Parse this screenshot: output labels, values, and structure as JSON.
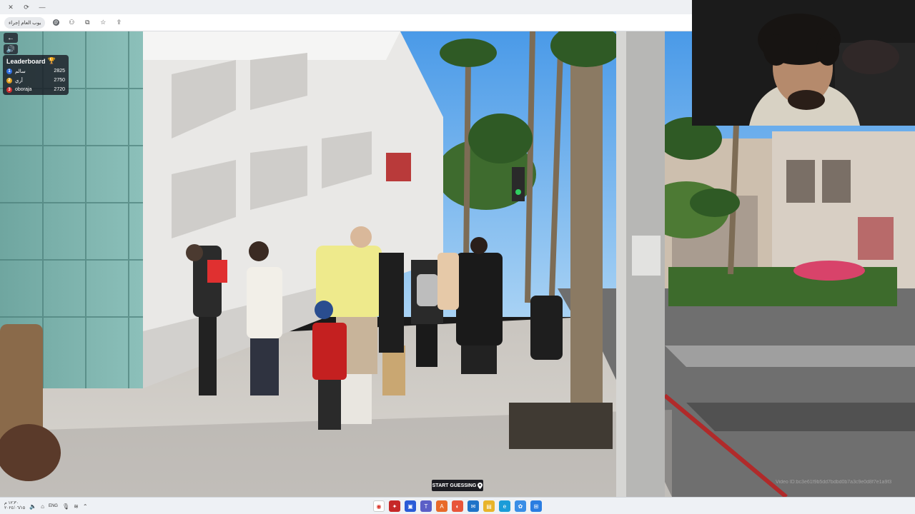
{
  "browser": {
    "window_controls": [
      "✕",
      "⟳",
      "—"
    ],
    "site_pill": "يوب العام إجراء",
    "toolbar_icons": [
      "site-settings-icon",
      "profile-icon",
      "extensions-icon",
      "bookmark-icon",
      "share-icon"
    ]
  },
  "game": {
    "back_button": "←",
    "sound_button": "🔊",
    "leaderboard": {
      "title": "Leaderboard",
      "trophy": "🏆",
      "entries": [
        {
          "rank": "1",
          "name": "سالم",
          "score": "2825",
          "color": "#2f6fe0"
        },
        {
          "rank": "2",
          "name": "أري",
          "score": "2750",
          "color": "#e0a020"
        },
        {
          "rank": "3",
          "name": "oboraja",
          "score": "2720",
          "color": "#d03030"
        }
      ]
    },
    "start_guessing": "START GUESSING",
    "pin_icon": "map-pin-icon",
    "watermark": "Video ID:bc3e61f9b5dd7bdbd0b7a3c9e0d8f7e1a9f3"
  },
  "taskbar": {
    "clock_time": "١٢:٣٠ م",
    "clock_date": "٢٠٢٤/٠٦/١٥",
    "language": "ENG",
    "tray_icons": [
      "mic-icon",
      "wifi-icon",
      "chevron-up-icon"
    ],
    "apps": [
      {
        "name": "chrome",
        "color": "#ffffff",
        "glyph": "◉"
      },
      {
        "name": "app-red",
        "color": "#c62828",
        "glyph": "✦"
      },
      {
        "name": "store",
        "color": "#2a5bd7",
        "glyph": "▣"
      },
      {
        "name": "teams",
        "color": "#5b5fc7",
        "glyph": "T"
      },
      {
        "name": "office",
        "color": "#e86a2a",
        "glyph": "A"
      },
      {
        "name": "firefox",
        "color": "#e8553a",
        "glyph": "◐"
      },
      {
        "name": "outlook",
        "color": "#1e73c8",
        "glyph": "✉"
      },
      {
        "name": "files",
        "color": "#e8b42a",
        "glyph": "▤"
      },
      {
        "name": "edge",
        "color": "#1a9cd8",
        "glyph": "e"
      },
      {
        "name": "photos",
        "color": "#3a8ee6",
        "glyph": "✿"
      },
      {
        "name": "windows",
        "color": "#2a7de1",
        "glyph": "⊞"
      }
    ]
  }
}
